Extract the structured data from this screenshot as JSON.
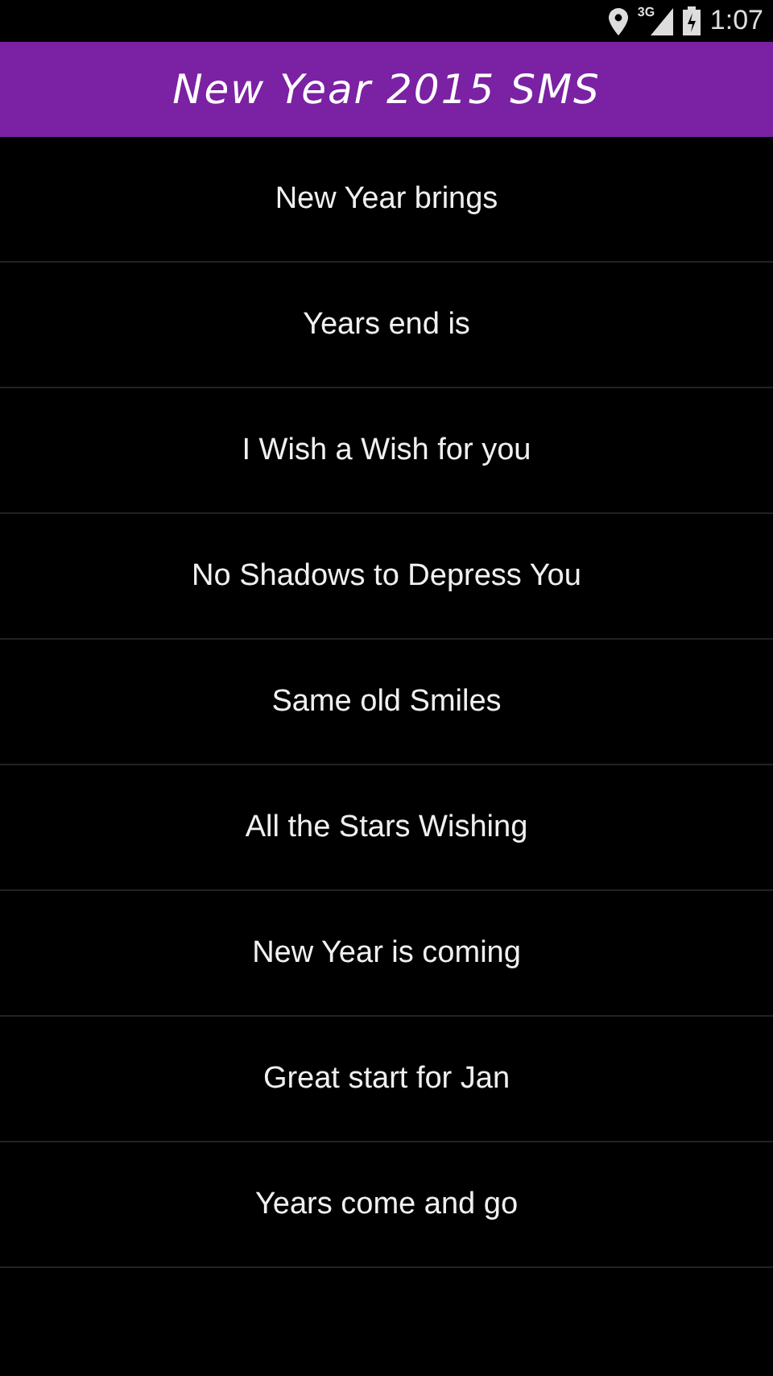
{
  "status_bar": {
    "network": "3G",
    "time": "1:07"
  },
  "title_bar": {
    "title": "New Year 2015 SMS"
  },
  "messages": [
    {
      "label": "New Year brings"
    },
    {
      "label": "Years end is"
    },
    {
      "label": "I Wish a Wish for you"
    },
    {
      "label": "No Shadows to Depress You"
    },
    {
      "label": "Same old Smiles"
    },
    {
      "label": "All the Stars Wishing"
    },
    {
      "label": "New Year is coming"
    },
    {
      "label": "Great start for Jan"
    },
    {
      "label": "Years come and go"
    }
  ]
}
